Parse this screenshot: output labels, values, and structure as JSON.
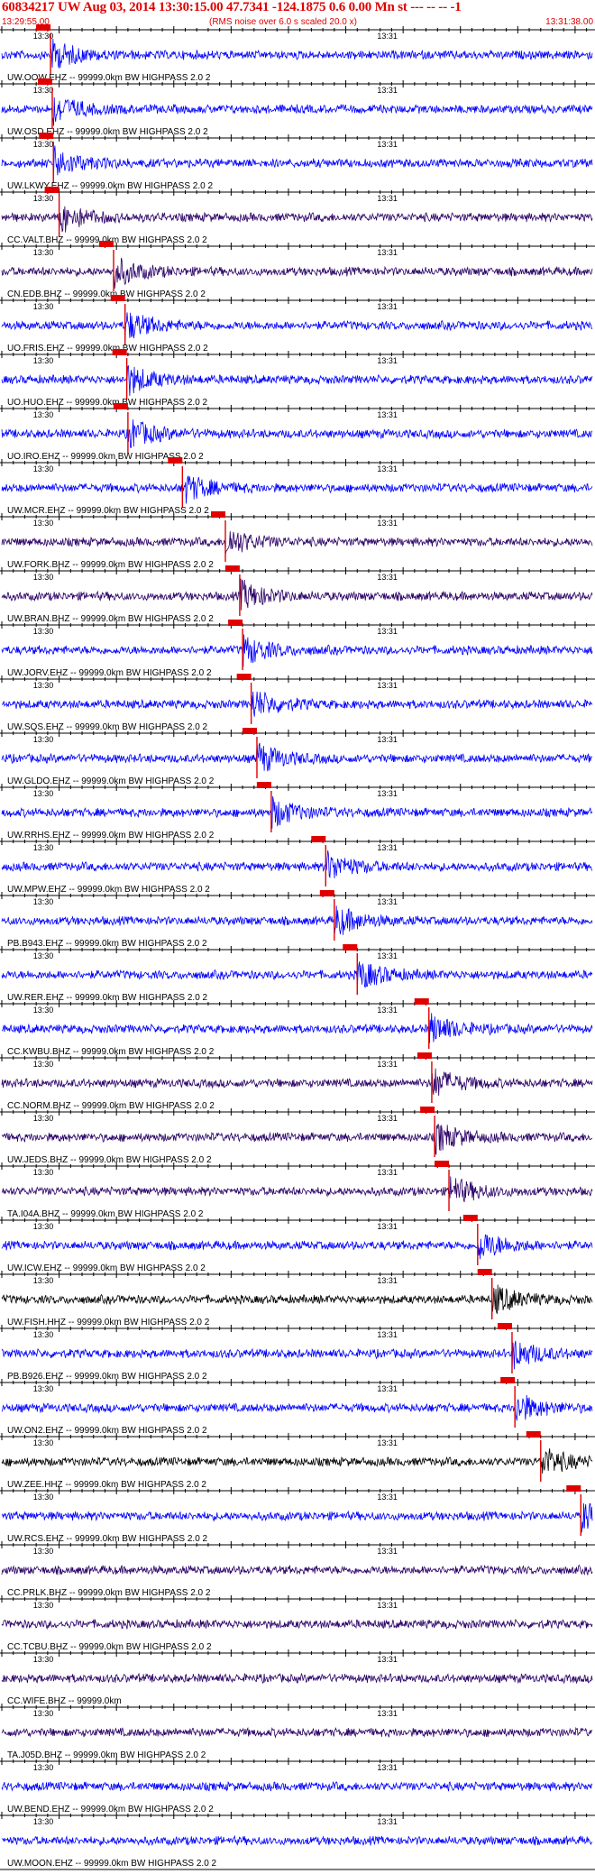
{
  "header": {
    "title": "60834217 UW Aug 03, 2014 13:30:15.00   47.7341 -124.1875  0.6 0.00 Mn st --- -- --   -1",
    "start_time": "13:29:55.00",
    "note": "(RMS noise over 6.0 s scaled 20.0 x)",
    "end_time": "13:31:38.00"
  },
  "colors": {
    "title": "#e00000",
    "pick_box": "#e00000",
    "blue": "#0000ff",
    "purple": "#2a0066",
    "black": "#000000"
  },
  "chart_data": {
    "type": "line",
    "title": "60834217 UW Aug 03, 2014 13:30:15.00   47.7341 -124.1875  0.6 0.00 Mn st --- -- --   -1",
    "x_unit": "time (UTC)",
    "x_range": [
      "13:29:55.00",
      "13:31:38.00"
    ],
    "grid": true,
    "tick_labels": [
      "13:30",
      "13:31"
    ],
    "traces": [
      {
        "label": "UW.OOW.EHZ -- 99999.0km BW  HIGHPASS  2.0  2",
        "color": "blue",
        "pick_s": 8.5
      },
      {
        "label": "UW.OSD.EHZ -- 99999.0km BW  HIGHPASS  2.0  2",
        "color": "blue",
        "pick_s": 8.8
      },
      {
        "label": "UW.LKWY.EHZ -- 99999.0km BW  HIGHPASS  2.0  2",
        "color": "blue",
        "pick_s": 9.0
      },
      {
        "label": "CC.VALT.BHZ -- 99999.0km BW  HIGHPASS  2.0  2",
        "color": "purple",
        "pick_s": 10.0
      },
      {
        "label": "CN.EDB.BHZ -- 99999.0km BW  HIGHPASS  2.0  2",
        "color": "purple",
        "pick_s": 19.5
      },
      {
        "label": "UO.FRIS.EHZ -- 99999.0km BW  HIGHPASS  2.0  2",
        "color": "blue",
        "pick_s": 21.5
      },
      {
        "label": "UO.HUO.EHZ -- 99999.0km BW  HIGHPASS  2.0  2",
        "color": "blue",
        "pick_s": 21.8
      },
      {
        "label": "UO.IRO.EHZ -- 99999.0km BW  HIGHPASS  2.0  2",
        "color": "blue",
        "pick_s": 22.0
      },
      {
        "label": "UW.MCR.EHZ -- 99999.0km BW  HIGHPASS  2.0  2",
        "color": "blue",
        "pick_s": 31.5
      },
      {
        "label": "UW.FORK.BHZ -- 99999.0km BW  HIGHPASS  2.0  2",
        "color": "purple",
        "pick_s": 39.0
      },
      {
        "label": "UW.BRAN.BHZ -- 99999.0km BW  HIGHPASS  2.0  2",
        "color": "purple",
        "pick_s": 41.5
      },
      {
        "label": "UW.JORV.EHZ -- 99999.0km BW  HIGHPASS  2.0  2",
        "color": "blue",
        "pick_s": 42.0
      },
      {
        "label": "UW.SQS.EHZ -- 99999.0km BW  HIGHPASS  2.0  2",
        "color": "blue",
        "pick_s": 43.5
      },
      {
        "label": "UW.GLDO.EHZ -- 99999.0km BW  HIGHPASS  2.0  2",
        "color": "blue",
        "pick_s": 44.5
      },
      {
        "label": "UW.RRHS.EHZ -- 99999.0km BW  HIGHPASS  2.0  2",
        "color": "blue",
        "pick_s": 47.0
      },
      {
        "label": "UW.MPW.EHZ -- 99999.0km BW  HIGHPASS  2.0  2",
        "color": "blue",
        "pick_s": 56.5
      },
      {
        "label": "PB.B943.EHZ -- 99999.0km BW  HIGHPASS  2.0  2",
        "color": "blue",
        "pick_s": 58.0
      },
      {
        "label": "UW.RER.EHZ -- 99999.0km BW  HIGHPASS  2.0  2",
        "color": "blue",
        "pick_s": 62.0
      },
      {
        "label": "CC.KWBU.BHZ -- 99999.0km BW  HIGHPASS  2.0  2",
        "color": "blue",
        "pick_s": 74.5
      },
      {
        "label": "CC.NORM.BHZ -- 99999.0km BW  HIGHPASS  2.0  2",
        "color": "purple",
        "pick_s": 75.0
      },
      {
        "label": "UW.JEDS.BHZ -- 99999.0km BW  HIGHPASS  2.0  2",
        "color": "purple",
        "pick_s": 75.5
      },
      {
        "label": "TA.I04A.BHZ -- 99999.0km BW  HIGHPASS  2.0  2",
        "color": "purple",
        "pick_s": 78.0
      },
      {
        "label": "UW.ICW.EHZ -- 99999.0km BW  HIGHPASS  2.0  2",
        "color": "blue",
        "pick_s": 83.0
      },
      {
        "label": "UW.FISH.HHZ -- 99999.0km BW  HIGHPASS  2.0  2",
        "color": "black",
        "pick_s": 85.5
      },
      {
        "label": "PB.B926.EHZ -- 99999.0km BW  HIGHPASS  2.0  2",
        "color": "blue",
        "pick_s": 89.0
      },
      {
        "label": "UW.ON2.EHZ -- 99999.0km BW  HIGHPASS  2.0  2",
        "color": "blue",
        "pick_s": 89.5
      },
      {
        "label": "UW.ZEE.HHZ -- 99999.0km BW  HIGHPASS  2.0  2",
        "color": "black",
        "pick_s": 94.0
      },
      {
        "label": "UW.RCS.EHZ -- 99999.0km BW  HIGHPASS  2.0  2",
        "color": "blue",
        "pick_s": 101.0
      },
      {
        "label": "CC.PRLK.BHZ -- 99999.0km BW  HIGHPASS  2.0  2",
        "color": "purple"
      },
      {
        "label": "CC.TCBU.BHZ -- 99999.0km BW  HIGHPASS  2.0  2",
        "color": "purple"
      },
      {
        "label": "CC.WIFE.BHZ -- 99999.0km",
        "color": "purple"
      },
      {
        "label": "TA.J05D.BHZ -- 99999.0km BW  HIGHPASS  2.0  2",
        "color": "purple"
      },
      {
        "label": "UW.BEND.EHZ -- 99999.0km BW  HIGHPASS  2.0  2",
        "color": "blue"
      },
      {
        "label": "UW.MOON.EHZ -- 99999.0km BW  HIGHPASS  2.0  2",
        "color": "blue"
      }
    ]
  }
}
